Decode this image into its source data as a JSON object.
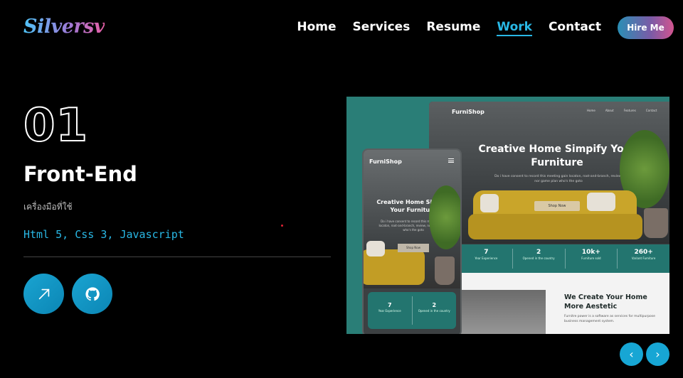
{
  "header": {
    "logo": "Silversv",
    "nav": [
      "Home",
      "Services",
      "Resume",
      "Work",
      "Contact"
    ],
    "active_nav": "Work",
    "hire_label": "Hire Me"
  },
  "project": {
    "number": "01",
    "title": "Front-End",
    "subtitle": "เครื่องมือที่ใช้",
    "stack": "Html 5, Css 3, Javascript",
    "buttons": {
      "live_icon": "arrow-up-right-icon",
      "repo_icon": "github-icon"
    }
  },
  "preview": {
    "brand": "FurniShop",
    "desktop_nav": [
      "Home",
      "About",
      "Features",
      "Contact"
    ],
    "hero_title": "Creative Home Simpify Your Furniture",
    "hero_desc": "Do i have consent to record this meeting gain locaton, root-and-branch, review, nor game plan who's the goto",
    "shop_label": "Shop Now",
    "stats": [
      {
        "value": "7",
        "label": "Year Experience"
      },
      {
        "value": "2",
        "label": "Opened in the country"
      },
      {
        "value": "10k+",
        "label": "Furniture sold"
      },
      {
        "value": "260+",
        "label": "Variant Furniture"
      }
    ],
    "section_title": "We Create Your Home More Aestetic",
    "section_desc": "Furnitre power is a software as services for multipurpose business management system.",
    "mobile_title": "Creative Home Simpify Your Furniture",
    "mobile_desc": "Do i have consent to record this meeting gain locaton, root-and-branch, review, nor game plan who's the goto",
    "mobile_stats": [
      {
        "value": "7",
        "label": "Year Experience"
      },
      {
        "value": "2",
        "label": "Opened in the country"
      }
    ]
  },
  "carousel": {
    "prev": "‹",
    "next": "›"
  },
  "colors": {
    "accent": "#29b8e5",
    "preview_bg": "#2a7e77"
  }
}
